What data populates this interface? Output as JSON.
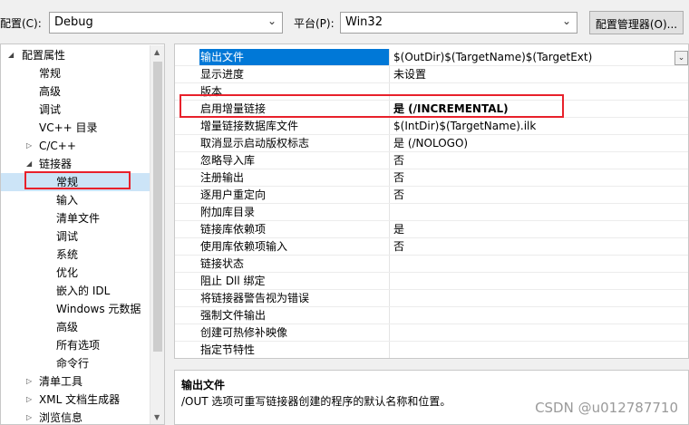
{
  "topbar": {
    "config_label": "配置(C):",
    "config_value": "Debug",
    "platform_label": "平台(P):",
    "platform_value": "Win32",
    "manager_button": "配置管理器(O)..."
  },
  "tree": {
    "items": [
      {
        "label": "配置属性",
        "expander": "◢"
      },
      {
        "label": "常规"
      },
      {
        "label": "高级"
      },
      {
        "label": "调试"
      },
      {
        "label": "VC++ 目录"
      },
      {
        "label": "C/C++",
        "expander": "▷"
      },
      {
        "label": "链接器",
        "expander": "◢"
      },
      {
        "label": "常规"
      },
      {
        "label": "输入"
      },
      {
        "label": "清单文件"
      },
      {
        "label": "调试"
      },
      {
        "label": "系统"
      },
      {
        "label": "优化"
      },
      {
        "label": "嵌入的 IDL"
      },
      {
        "label": "Windows 元数据"
      },
      {
        "label": "高级"
      },
      {
        "label": "所有选项"
      },
      {
        "label": "命令行"
      },
      {
        "label": "清单工具",
        "expander": "▷"
      },
      {
        "label": "XML 文档生成器",
        "expander": "▷"
      },
      {
        "label": "浏览信息",
        "expander": "▷"
      }
    ]
  },
  "grid": {
    "rows": [
      {
        "name": "输出文件",
        "value": "$(OutDir)$(TargetName)$(TargetExt)"
      },
      {
        "name": "显示进度",
        "value": "未设置"
      },
      {
        "name": "版本",
        "value": ""
      },
      {
        "name": "启用增量链接",
        "value": "是 (/INCREMENTAL)"
      },
      {
        "name": "增量链接数据库文件",
        "value": "$(IntDir)$(TargetName).ilk"
      },
      {
        "name": "取消显示启动版权标志",
        "value": "是 (/NOLOGO)"
      },
      {
        "name": "忽略导入库",
        "value": "否"
      },
      {
        "name": "注册输出",
        "value": "否"
      },
      {
        "name": "逐用户重定向",
        "value": "否"
      },
      {
        "name": "附加库目录",
        "value": ""
      },
      {
        "name": "链接库依赖项",
        "value": "是"
      },
      {
        "name": "使用库依赖项输入",
        "value": "否"
      },
      {
        "name": "链接状态",
        "value": ""
      },
      {
        "name": "阻止 Dll 绑定",
        "value": ""
      },
      {
        "name": "将链接器警告视为错误",
        "value": ""
      },
      {
        "name": "强制文件输出",
        "value": ""
      },
      {
        "name": "创建可热修补映像",
        "value": ""
      },
      {
        "name": "指定节特性",
        "value": ""
      }
    ]
  },
  "description": {
    "title": "输出文件",
    "body": "/OUT 选项可重写链接器创建的程序的默认名称和位置。"
  },
  "watermark": "CSDN @u012787710",
  "colors": {
    "highlight_red": "#e8212b",
    "selection_blue": "#0078d7",
    "tree_selection": "#cce4f7"
  },
  "icons": {
    "combo_arrow": "chevron-down-icon",
    "expanded": "triangle-expanded-icon",
    "collapsed": "triangle-collapsed-icon"
  }
}
